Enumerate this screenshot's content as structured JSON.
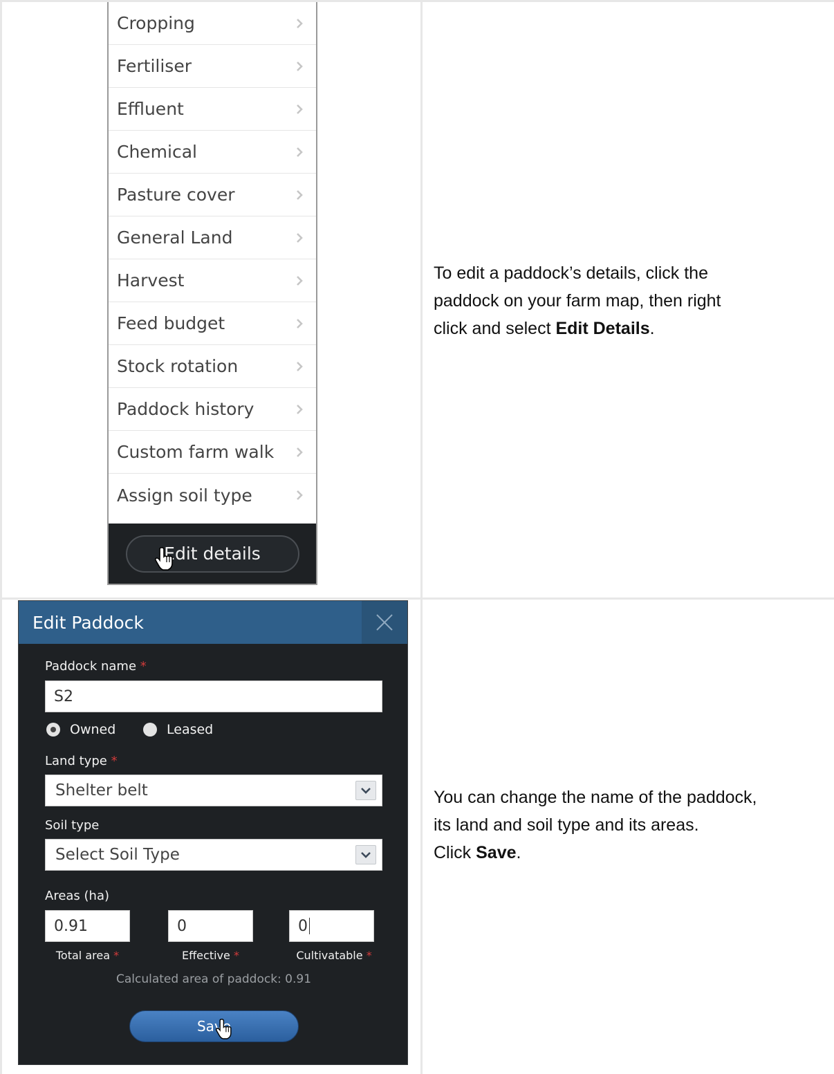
{
  "menu": {
    "items": [
      {
        "label": "Cropping"
      },
      {
        "label": "Fertiliser"
      },
      {
        "label": "Effluent"
      },
      {
        "label": "Chemical"
      },
      {
        "label": "Pasture cover"
      },
      {
        "label": "General Land"
      },
      {
        "label": "Harvest"
      },
      {
        "label": "Feed budget"
      },
      {
        "label": "Stock rotation"
      },
      {
        "label": "Paddock history"
      },
      {
        "label": "Custom farm walk"
      },
      {
        "label": "Assign soil type"
      }
    ],
    "edit_button_label": "Edit details"
  },
  "instructions": {
    "step1_line1": "To edit a paddock’s details, click the",
    "step1_line2": "paddock on your farm map, then right",
    "step1_line3_prefix": "click and select ",
    "step1_line3_bold": "Edit Details",
    "step1_line3_suffix": ".",
    "step2_line1": "You can change the name of the paddock,",
    "step2_line2": "its land and soil type and its areas.",
    "step2_line3_prefix": "Click ",
    "step2_line3_bold": "Save",
    "step2_line3_suffix": "."
  },
  "dialog": {
    "title": "Edit Paddock",
    "paddock_name_label": "Paddock name",
    "required_mark": "*",
    "paddock_name_value": "S2",
    "ownership_options": [
      "Owned",
      "Leased"
    ],
    "ownership_selected": "Owned",
    "land_type_label": "Land type",
    "land_type_value": "Shelter belt",
    "soil_type_label": "Soil type",
    "soil_type_value": "Select Soil Type",
    "areas_label": "Areas (ha)",
    "total_area_value": "0.91",
    "effective_value": "0",
    "cultivatable_value": "0",
    "total_area_caption": "Total area",
    "effective_caption": "Effective",
    "cultivatable_caption": "Cultivatable",
    "calculated_text": "Calculated area of paddock: 0.91",
    "save_label": "Save"
  },
  "colors": {
    "dialog_bg": "#1e2124",
    "header_blue": "#2f5f8a",
    "save_blue": "#3a72b4",
    "required_red": "#d23b3b"
  }
}
